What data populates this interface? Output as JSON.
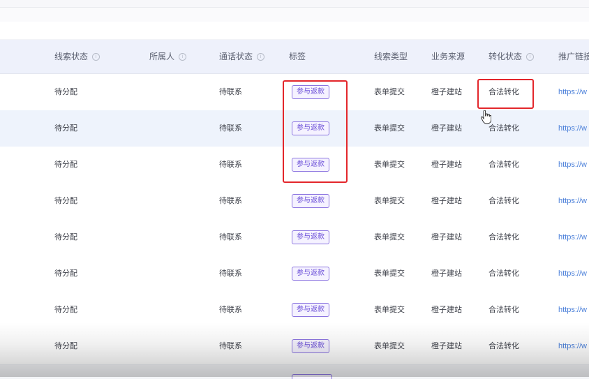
{
  "table": {
    "columns": [
      {
        "key": "lead_status",
        "label": "线索状态",
        "info": true
      },
      {
        "key": "owner",
        "label": "所属人",
        "info": true
      },
      {
        "key": "call_status",
        "label": "通话状态",
        "info": true
      },
      {
        "key": "tags",
        "label": "标签",
        "info": false
      },
      {
        "key": "lead_type",
        "label": "线索类型",
        "info": false
      },
      {
        "key": "source",
        "label": "业务来源",
        "info": false
      },
      {
        "key": "conversion_status",
        "label": "转化状态",
        "info": true
      },
      {
        "key": "promo_link",
        "label": "推广链接",
        "info": false
      }
    ],
    "info_glyph": "i",
    "rows": [
      {
        "lead_status": "待分配",
        "owner": "",
        "call_status": "待联系",
        "tag": "参与返款",
        "lead_type": "表单提交",
        "source": "橙子建站",
        "conversion_status": "合法转化",
        "promo_link": "https://w"
      },
      {
        "lead_status": "待分配",
        "owner": "",
        "call_status": "待联系",
        "tag": "参与返款",
        "lead_type": "表单提交",
        "source": "橙子建站",
        "conversion_status": "合法转化",
        "promo_link": "https://w"
      },
      {
        "lead_status": "待分配",
        "owner": "",
        "call_status": "待联系",
        "tag": "参与返款",
        "lead_type": "表单提交",
        "source": "橙子建站",
        "conversion_status": "合法转化",
        "promo_link": "https://w"
      },
      {
        "lead_status": "待分配",
        "owner": "",
        "call_status": "待联系",
        "tag": "参与返款",
        "lead_type": "表单提交",
        "source": "橙子建站",
        "conversion_status": "合法转化",
        "promo_link": "https://w"
      },
      {
        "lead_status": "待分配",
        "owner": "",
        "call_status": "待联系",
        "tag": "参与返款",
        "lead_type": "表单提交",
        "source": "橙子建站",
        "conversion_status": "合法转化",
        "promo_link": "https://w"
      },
      {
        "lead_status": "待分配",
        "owner": "",
        "call_status": "待联系",
        "tag": "参与返款",
        "lead_type": "表单提交",
        "source": "橙子建站",
        "conversion_status": "合法转化",
        "promo_link": "https://w"
      },
      {
        "lead_status": "待分配",
        "owner": "",
        "call_status": "待联系",
        "tag": "参与返款",
        "lead_type": "表单提交",
        "source": "橙子建站",
        "conversion_status": "合法转化",
        "promo_link": "https://w"
      },
      {
        "lead_status": "待分配",
        "owner": "",
        "call_status": "待联系",
        "tag": "参与返款",
        "lead_type": "表单提交",
        "source": "橙子建站",
        "conversion_status": "合法转化",
        "promo_link": "https://w"
      }
    ],
    "hovered_row_index": 1
  },
  "colors": {
    "header_bg": "#eef1fb",
    "hover_row_bg": "#eef3fc",
    "tag_purple": "#6b4fd8",
    "link_blue": "#4a7fd9",
    "annotation_red": "#e3262b"
  },
  "cursor_icon": "hand-pointer-icon"
}
